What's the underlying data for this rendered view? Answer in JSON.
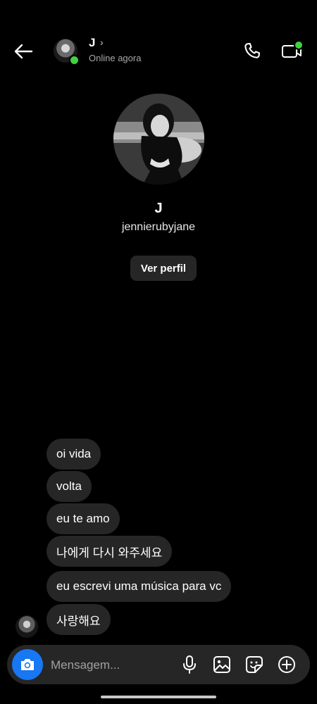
{
  "header": {
    "name": "J",
    "status": "Online agora",
    "chevron": "›",
    "icons": {
      "back": "arrow-left-icon",
      "call": "phone-icon",
      "video": "video-camera-icon"
    },
    "online_color": "#3fd33f"
  },
  "profile": {
    "name": "J",
    "username": "jennierubyjane",
    "view_profile_label": "Ver perfil"
  },
  "messages": [
    {
      "text": "oi vida"
    },
    {
      "text": "volta"
    },
    {
      "text": "eu te amo"
    },
    {
      "text": "나에게 다시 와주세요"
    },
    {
      "text": "eu escrevi uma música para vc"
    },
    {
      "text": "사랑해요"
    }
  ],
  "composer": {
    "placeholder": "Mensagem...",
    "icons": [
      "camera-icon",
      "microphone-icon",
      "image-icon",
      "sticker-icon",
      "plus-circle-icon"
    ],
    "camera_color": "#1877f2"
  },
  "theme": {
    "background": "#000000",
    "bubble": "#262626",
    "muted_text": "#a8a8a8"
  }
}
